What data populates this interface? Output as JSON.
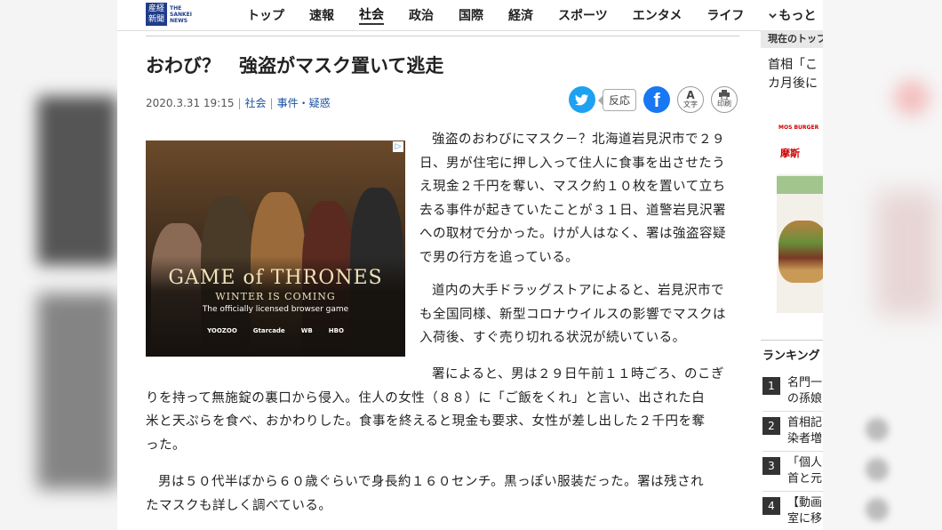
{
  "header": {
    "logo_mark": "産経新聞",
    "logo_text": "THE SANKEI NEWS",
    "nav": [
      "トップ",
      "速報",
      "社会",
      "政治",
      "国際",
      "経済",
      "スポーツ",
      "エンタメ",
      "ライフ"
    ],
    "active_nav": "社会",
    "more_label": "もっと"
  },
  "article": {
    "title": "おわび？　強盗がマスク置いて逃走",
    "date": "2020.3.31 19:15",
    "category": "社会",
    "subcategory": "事件・疑惑",
    "paragraphs": [
      [
        "強盗のおわびにマスク－？北海道岩見沢市で２９",
        "日、男が住宅に押し入って住人に食事を出させたう",
        "え現金２千円を奪い、マスク約１０枚を置いて立ち",
        "去る事件が起きていたことが３１日、道警岩見沢署",
        "への取材で分かった。けが人はなく、署は強盗容疑",
        "で男の行方を追っている。"
      ],
      [
        "道内の大手ドラッグストアによると、岩見沢市で",
        "も全国同様、新型コロナウイルスの影響でマスクは",
        "入荷後、すぐ売り切れる状況が続いている。"
      ],
      [
        "署によると、男は２９日午前１１時ごろ、のこぎ",
        "りを持って無施錠の裏口から侵入。住人の女性（８８）に「ご飯をくれ」と言い、出された白",
        "米と天ぷらを食べ、おかわりした。食事を終えると現金も要求、女性が差し出した２千円を奪",
        "った。"
      ],
      [
        "男は５０代半ばから６０歳ぐらいで身長約１６０センチ。黒っぽい服装だった。署は残され",
        "たマスクも詳しく調べている。"
      ]
    ]
  },
  "social": {
    "reaction_label": "反応",
    "font_icon_label": "文字",
    "print_label": "印刷",
    "font_big": "A"
  },
  "ad": {
    "title_line1": "GAME of THRONES",
    "title_line2": "WINTER IS COMING",
    "subtitle": "The officially licensed browser game",
    "sponsors": [
      "YOOZOO",
      "Gtarcade",
      "WB",
      "HBO"
    ]
  },
  "sidebar": {
    "header": "現在のトップ",
    "news": "首相「こ\nカ月後に",
    "ad_brand": "MOS BURGER",
    "ad_text": "摩斯",
    "ranking_header": "ランキング",
    "ranking": [
      {
        "num": "1",
        "text": "名門一\nの孫娘"
      },
      {
        "num": "2",
        "text": "首相記\n染者増"
      },
      {
        "num": "3",
        "text": "「個人\n首と元"
      },
      {
        "num": "4",
        "text": "【動画\n室に移"
      }
    ]
  },
  "colors": {
    "twitter": "#1da1f2",
    "facebook": "#1877f2",
    "link": "#1a4fa0",
    "logo": "#1f3d8a"
  }
}
